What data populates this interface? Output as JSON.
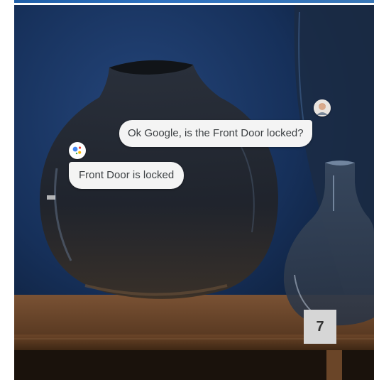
{
  "conversation": {
    "user_message": "Ok Google, is the Front Door locked?",
    "assistant_reply": "Front Door is locked"
  },
  "icons": {
    "user_avatar": "user-avatar-icon",
    "assistant": "google-assistant-icon"
  },
  "colors": {
    "wall": "#142a4c",
    "shelf": "#5a3a22",
    "bubble": "#f4f4f4",
    "assistant_blue": "#4285f4",
    "assistant_red": "#ea4335",
    "assistant_yellow": "#fbbc05",
    "assistant_green": "#34a853"
  },
  "badge": {
    "number": "7"
  }
}
